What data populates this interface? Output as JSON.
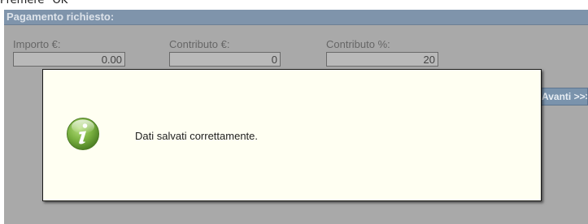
{
  "caption": "Premere \"OK\"",
  "panel": {
    "title": "Pagamento richiesto:",
    "fields": [
      {
        "label": "Importo €:",
        "value": "0.00"
      },
      {
        "label": "Contributo €:",
        "value": "0"
      },
      {
        "label": "Contributo %:",
        "value": "20"
      }
    ],
    "side_button_label": "Avanti >>>"
  },
  "dialog": {
    "icon": "info-icon",
    "message": "Dati salvati correttamente."
  },
  "colors": {
    "overlay": "#a9a9a9",
    "header": "#7f94ab",
    "dialog_background": "#fffff2",
    "icon_green": "#6fa33a"
  }
}
